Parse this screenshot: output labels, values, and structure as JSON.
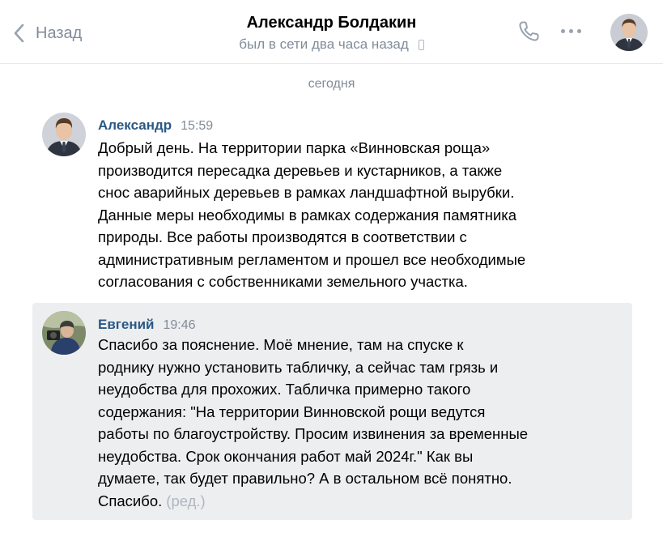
{
  "header": {
    "back_label": "Назад",
    "peer_name": "Александр Болдакин",
    "peer_status": "был в сети два часа назад"
  },
  "date_separator": "сегодня",
  "messages": [
    {
      "author": "Александр",
      "time": "15:59",
      "lines": [
        "Добрый день. На территории парка «Винновская роща»",
        "производится пересадка деревьев и кустарников, а также",
        "снос аварийных деревьев в рамках ландшафтной вырубки.",
        "Данные меры необходимы в рамках содержания памятника",
        "природы. Все работы производятся в соответствии с",
        "административным регламентом и прошел все необходимые",
        "согласования с собственниками земельного участка."
      ]
    },
    {
      "author": "Евгений",
      "time": "19:46",
      "lines": [
        "Спасибо за пояснение. Моё мнение, там на спуске к",
        "роднику нужно установить табличку, а сейчас там грязь и",
        "неудобства для прохожих. Табличка примерно такого",
        "содержания: \"На территории Винновской рощи ведутся",
        "работы по благоустройству. Просим извинения за временные",
        "неудобства. Срок окончания работ май 2024г.\" Как вы",
        "думаете, так будет правильно? А в остальном всё понятно.",
        "Спасибо."
      ],
      "edited_label": "(ред.)"
    }
  ],
  "colors": {
    "accent_link": "#2a5885",
    "secondary_text": "#818c99",
    "highlight_bg": "#edeef0"
  },
  "icons": [
    "chevron-left-icon",
    "phone-icon",
    "more-dots-icon",
    "mobile-device-icon"
  ]
}
